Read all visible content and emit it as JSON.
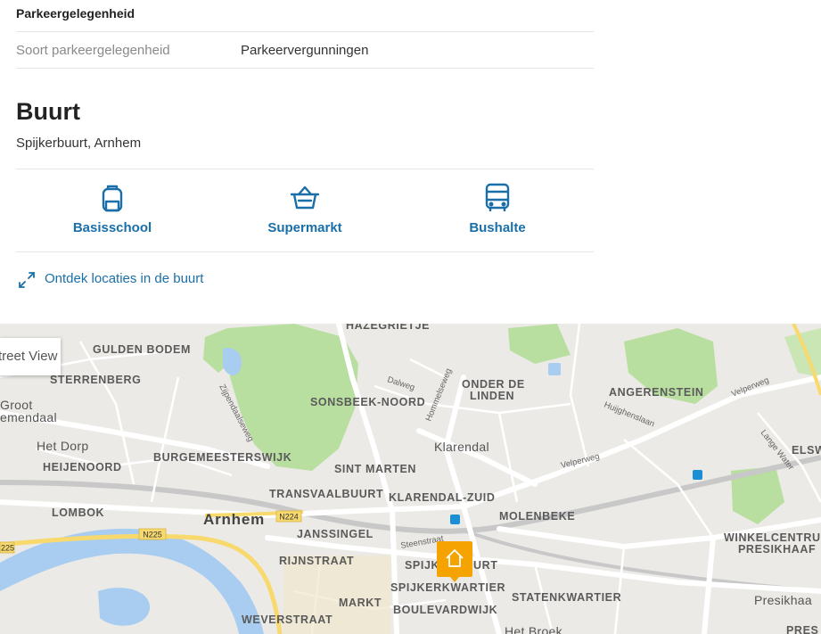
{
  "parking": {
    "section_title": "Parkeergelegenheid",
    "rows": [
      {
        "key": "Soort parkeergelegenheid",
        "value": "Parkeervergunningen"
      }
    ]
  },
  "neighborhood": {
    "title": "Buurt",
    "location": "Spijkerbuurt, Arnhem",
    "amenities": [
      {
        "label": "Basisschool",
        "icon": "backpack-icon"
      },
      {
        "label": "Supermarkt",
        "icon": "basket-icon"
      },
      {
        "label": "Bushalte",
        "icon": "bus-icon"
      }
    ],
    "explore_label": "Ontdek locaties in de buurt",
    "explore_icon": "expand-arrows-icon"
  },
  "map": {
    "street_view_label": "Street View",
    "places": [
      "HAZEGRIETJE",
      "GULDEN BODEM",
      "STERRENBERG",
      "Groot",
      "emendaal",
      "SONSBEEK-NOORD",
      "ONDER DE",
      "LINDEN",
      "ANGERENSTEIN",
      "Het Dorp",
      "HEIJENOORD",
      "BURGEMEESTERSWIJK",
      "Klarendal",
      "SINT MARTEN",
      "ELSW",
      "TRANSVAALBUURT",
      "KLARENDAL-ZUID",
      "LOMBOK",
      "Arnhem",
      "MOLENBEKE",
      "JANSSINGEL",
      "WINKELCENTRU",
      "PRESIKHAAF",
      "RIJNSTRAAT",
      "SPIJKERBUURT",
      "SPIJKERKWARTIER",
      "STATENKWARTIER",
      "MARKT",
      "BOULEVARDWIJK",
      "Presikhaa",
      "WEVERSTRAAT",
      "Het Broek",
      "PRES"
    ],
    "streets": [
      "Dalweg",
      "Hommelseweg",
      "Zijpendaalseweg",
      "Velperweg",
      "Huijghenslaan",
      "Lange Water",
      "Steenstraat",
      "Velperweg"
    ],
    "road_shields": [
      "N224",
      "N225",
      "225"
    ],
    "colors": {
      "land": "#eceae6",
      "park": "#b8dea0",
      "water": "#a9cdf0",
      "highway": "#f8d96e",
      "accent": "#1a6fa8",
      "pin": "#f5a300"
    },
    "home_marker_icon": "home-icon"
  }
}
